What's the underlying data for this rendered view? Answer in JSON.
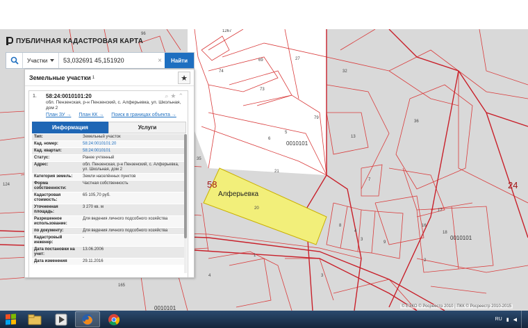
{
  "app": {
    "title": "ПУБЛИЧНАЯ КАДАСТРОВАЯ КАРТА"
  },
  "search": {
    "type_label": "Участки",
    "value": "53,032691 45,151920",
    "find_label": "Найти"
  },
  "panel": {
    "title": "Земельные участки",
    "count": "1",
    "card": {
      "index": "1.",
      "cad_id": "58:24:0010101:20",
      "address": "обл. Пензенская, р-н Пензенский, с. Алферьевка, ул. Школьная, дом 2",
      "links": [
        "План ЗУ →",
        "План КК →",
        "Поиск в границах объекта →"
      ]
    },
    "tabs": {
      "info": "Информация",
      "services": "Услуги"
    },
    "attributes": [
      {
        "label": "Тип:",
        "value": "Земельный участок",
        "link": false
      },
      {
        "label": "Кад. номер:",
        "value": "58:24:0010101:20",
        "link": true
      },
      {
        "label": "Кад. квартал:",
        "value": "58:24:0010101",
        "link": true
      },
      {
        "label": "Статус:",
        "value": "Ранее учтенный",
        "link": false
      },
      {
        "label": "Адрес:",
        "value": "обл. Пензенская, р-н Пензенский, с. Алферьевка, ул. Школьная, дом 2",
        "link": false
      },
      {
        "label": "Категория земель:",
        "value": "Земли населённых пунктов",
        "link": false
      },
      {
        "label": "Форма собственности:",
        "value": "Частная собственность",
        "link": false
      },
      {
        "label": "Кадастровая стоимость:",
        "value": "65 105,70 руб.",
        "link": false
      },
      {
        "label": "Уточненная площадь:",
        "value": "3 270 кв. м",
        "link": false
      },
      {
        "label": "Разрешенное использование:",
        "value": "Для ведения личного подсобного хозяйства",
        "link": false
      },
      {
        "label": "по документу:",
        "value": "Для ведения личного подсобного хозяйства",
        "link": false
      },
      {
        "label": "Кадастровый инженер:",
        "value": "-",
        "link": false
      },
      {
        "label": "Дата постановки на учет:",
        "value": "13.06.2006",
        "link": false
      },
      {
        "label": "Дата изменения",
        "value": "29.11.2016",
        "link": false
      }
    ]
  },
  "map": {
    "place_name": "Алферьевка",
    "district_labels": [
      "58",
      "24"
    ],
    "quarter_labels": [
      "0010101",
      "0010101",
      "0010101"
    ],
    "parcel_numbers": [
      "96",
      "1267",
      "74",
      "69",
      "27",
      "73",
      "79",
      "5",
      "6",
      "13",
      "21",
      "35",
      "36",
      "32",
      "7",
      "124",
      "20",
      "17",
      "16",
      "18",
      "8",
      "4",
      "3",
      "9",
      "2",
      "165",
      "1",
      "3",
      "4"
    ],
    "copyright": "© ЕЭКО © Росреестр 2010 | ПКК © Росреестр 2010-2015"
  },
  "taskbar": {
    "language": "RU",
    "colors": {
      "bar": "#1c3350",
      "accent": "#1e66b5"
    },
    "icons": [
      "windows-start-icon",
      "explorer-icon",
      "media-player-icon",
      "firefox-icon",
      "chrome-icon"
    ]
  }
}
